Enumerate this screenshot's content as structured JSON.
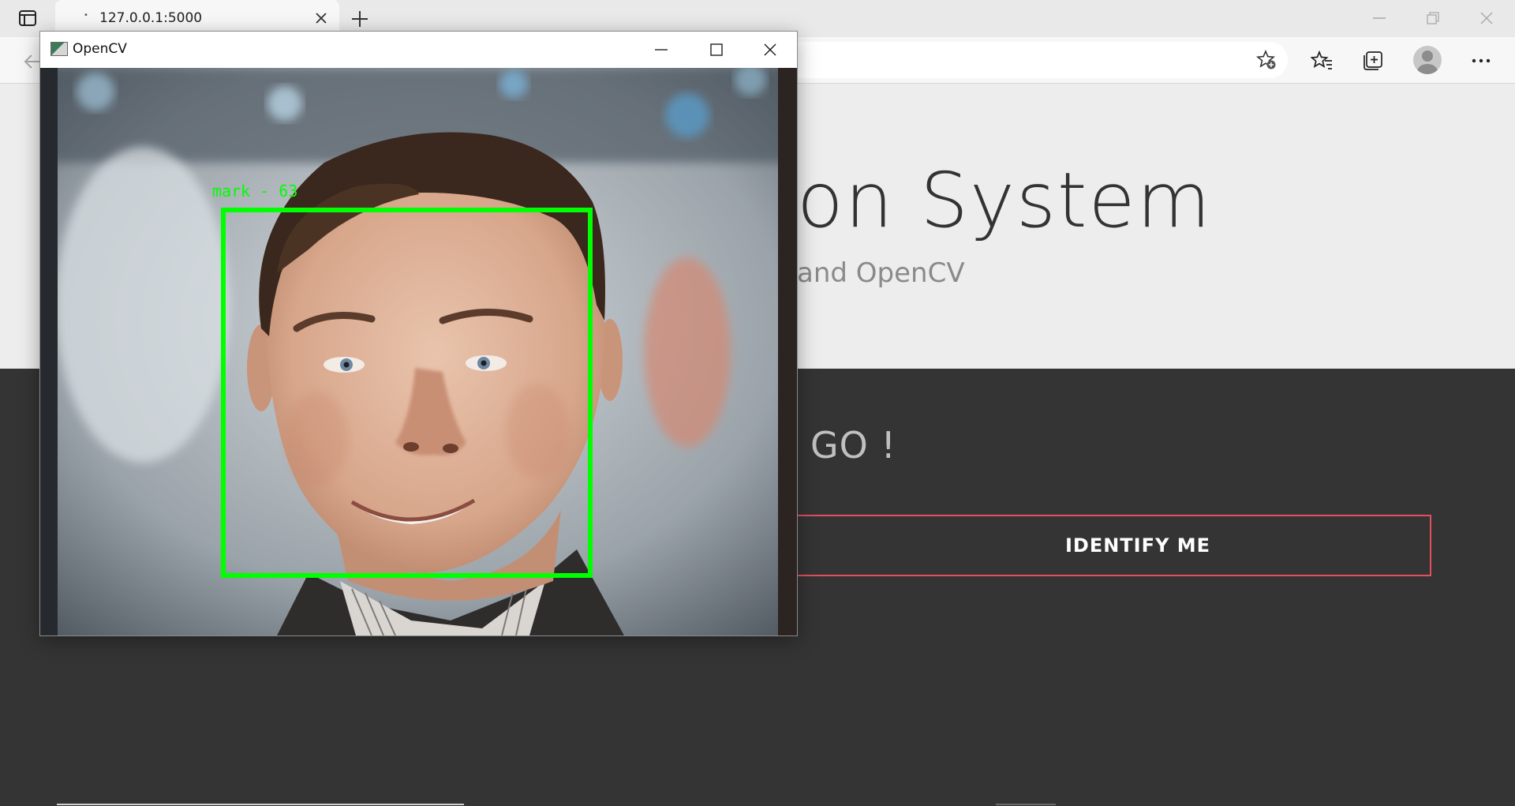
{
  "browser": {
    "tab_title": "127.0.0.1:5000",
    "tab_favicon": "•"
  },
  "page": {
    "hero_title_visible": "on System",
    "hero_subtitle_visible": "and OpenCV",
    "go_text": "GO !",
    "identify_button": "IDENTIFY ME"
  },
  "cv_window": {
    "title": "OpenCV",
    "detection_label": "mark - 63"
  },
  "colors": {
    "dark_section": "#343434",
    "button_border": "#e0505e",
    "detection_box": "#00ff00"
  },
  "icons": [
    "tab-actions-icon",
    "close-icon",
    "plus-icon",
    "minimize-icon",
    "restore-icon",
    "back-arrow-icon",
    "add-favorite-icon",
    "favorites-icon",
    "collections-icon",
    "profile-avatar",
    "more-icon",
    "opencv-app-icon",
    "maximize-icon"
  ]
}
